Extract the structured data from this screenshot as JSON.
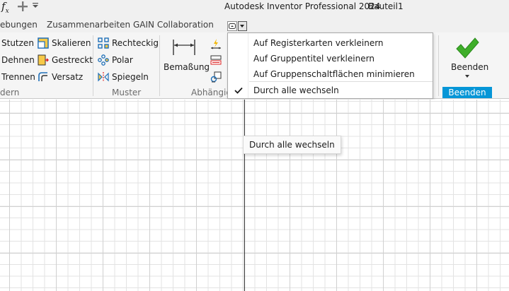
{
  "titlebar": {
    "fx_symbol": "f",
    "fx_sub": "x",
    "app_title": "Autodesk Inventor Professional 2024",
    "document_title": "Bauteil1"
  },
  "tabs": [
    {
      "label": "ebungen"
    },
    {
      "label": "Zusammenarbeiten"
    },
    {
      "label": "GAIN Collaboration"
    }
  ],
  "ribbon": {
    "modify_group": {
      "items": [
        {
          "label": "Stutzen",
          "icon": "trim-icon"
        },
        {
          "label": "Dehnen",
          "icon": "extend-icon"
        },
        {
          "label": "Trennen",
          "icon": "split-icon"
        },
        {
          "label": "Skalieren",
          "icon": "scale-icon"
        },
        {
          "label": "Gestreckt",
          "icon": "stretch-icon"
        },
        {
          "label": "Versatz",
          "icon": "offset-icon"
        }
      ],
      "label": "dern"
    },
    "pattern_group": {
      "items": [
        {
          "label": "Rechteckig",
          "icon": "rectangular-pattern-icon"
        },
        {
          "label": "Polar",
          "icon": "polar-pattern-icon"
        },
        {
          "label": "Spiegeln",
          "icon": "mirror-icon"
        }
      ],
      "label": "Muster"
    },
    "constrain_group": {
      "dimension_label": "Bemaßung",
      "label": "Abhängig"
    },
    "exit_group": {
      "button_label": "Beenden",
      "label": "Beenden"
    }
  },
  "ribbon_menu": {
    "items": [
      {
        "label": "Auf Registerkarten verkleinern",
        "checked": false
      },
      {
        "label": "Auf Gruppentitel verkleinern",
        "checked": false
      },
      {
        "label": "Auf Gruppenschaltflächen minimieren",
        "checked": false
      },
      {
        "label": "Durch alle wechseln",
        "checked": true
      }
    ]
  },
  "tooltip": {
    "text": "Durch alle wechseln"
  },
  "colors": {
    "accent": "#0696d7",
    "check_green": "#3fae2a",
    "ribbon_bg": "#f5f5f5"
  }
}
